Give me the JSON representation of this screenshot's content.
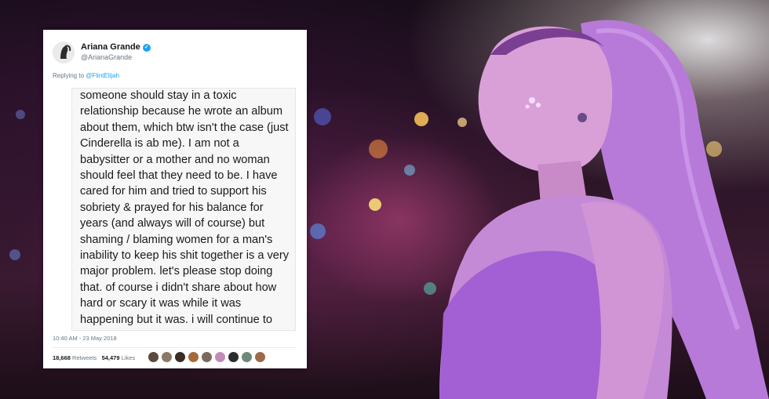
{
  "tweet": {
    "display_name": "Ariana Grande",
    "handle": "@ArianaGrande",
    "replying_prefix": "Replying to",
    "replying_to": "@FlintElijah",
    "body": "someone should stay in a toxic relationship because he wrote an album about them, which btw isn't the case (just Cinderella is ab me). I am not a babysitter or a mother and no woman should feel that they need to be. I have cared for him and tried to support his sobriety & prayed for his balance for years (and always will of course) but shaming / blaming women for a man's inability to keep his shit together is a very major problem. let's please stop doing that. of course i didn't share about how hard or scary it was while it was happening but it was. i will continue to pray from the bottom of my heart that he figures it all out and that any",
    "timestamp": "10:40 AM - 23 May 2018",
    "retweets_count": "18,668",
    "retweets_label": "Retweets",
    "likes_count": "54,479",
    "likes_label": "Likes"
  },
  "colors": {
    "verified_blue": "#1da1f2",
    "link_blue": "#1da1f2",
    "muted_gray": "#657786"
  },
  "liker_avatars": [
    "#5a4a3c",
    "#8a7a6a",
    "#3a2c24",
    "#a56a3a",
    "#7a6a5e",
    "#c28ab8",
    "#2c2c2c",
    "#6c8a7a",
    "#9a6a4a"
  ]
}
